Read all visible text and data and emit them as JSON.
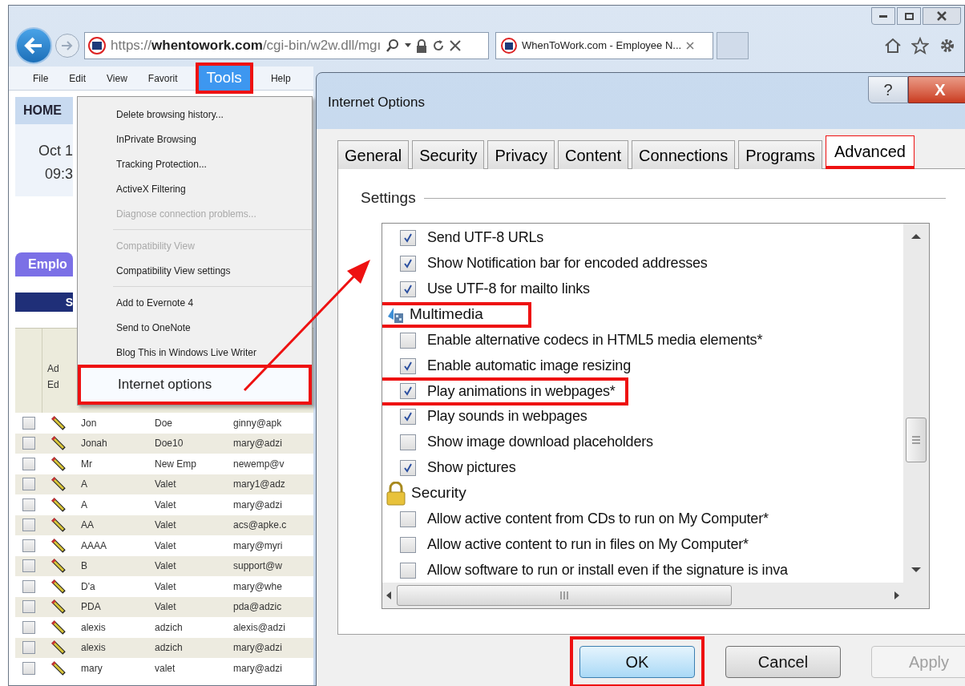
{
  "browser": {
    "address": "https://**whentowork.com**/cgi-bin/w2w.dll/mgı",
    "tab": {
      "title": "WhenToWork.com - Employee N...",
      "selected": true
    }
  },
  "menu_bar": [
    {
      "label": "File",
      "highlighted": false
    },
    {
      "label": "Edit",
      "highlighted": false
    },
    {
      "label": "View",
      "highlighted": false
    },
    {
      "label": "Favorit",
      "highlighted": false
    },
    {
      "label": "Tools",
      "highlighted": true
    },
    {
      "label": "Help",
      "highlighted": false
    }
  ],
  "page": {
    "home_tab": "HOME",
    "date": "Oct 1",
    "time": "09:3",
    "section_tab": "Emplo",
    "bar_label": "S",
    "edit_header": "Ad Ed",
    "rows": [
      {
        "first": "Jon",
        "last": "Doe",
        "email": "ginny@apk",
        "checked": false
      },
      {
        "first": "Jonah",
        "last": "Doe10",
        "email": "mary@adzi",
        "checked": false
      },
      {
        "first": "Mr",
        "last": "New Emp",
        "email": "newemp@v",
        "checked": false
      },
      {
        "first": "A",
        "last": "Valet",
        "email": "mary1@adz",
        "checked": false
      },
      {
        "first": "A",
        "last": "Valet",
        "email": "mary@adzi",
        "checked": false
      },
      {
        "first": "AA",
        "last": "Valet",
        "email": "acs@apke.c",
        "checked": false
      },
      {
        "first": "AAAA",
        "last": "Valet",
        "email": "mary@myri",
        "checked": false
      },
      {
        "first": "B",
        "last": "Valet",
        "email": "support@w",
        "checked": false
      },
      {
        "first": "D'a",
        "last": "Valet",
        "email": "mary@whe",
        "checked": false
      },
      {
        "first": "PDA",
        "last": "Valet",
        "email": "pda@adzic",
        "checked": false
      },
      {
        "first": "alexis",
        "last": "adzich",
        "email": "alexis@adzi",
        "checked": false
      },
      {
        "first": "alexis",
        "last": "adzich",
        "email": "mary@adzi",
        "checked": false
      },
      {
        "first": "mary",
        "last": "valet",
        "email": "mary@adzi",
        "checked": false
      }
    ]
  },
  "tools_menu": [
    {
      "kind": "item",
      "label": "Delete browsing history...",
      "disabled": false,
      "highlighted": false
    },
    {
      "kind": "item",
      "label": "InPrivate Browsing",
      "disabled": false,
      "highlighted": false
    },
    {
      "kind": "item",
      "label": "Tracking Protection...",
      "disabled": false,
      "highlighted": false
    },
    {
      "kind": "item",
      "label": "ActiveX Filtering",
      "disabled": false,
      "highlighted": false
    },
    {
      "kind": "item",
      "label": "Diagnose connection problems...",
      "disabled": true,
      "highlighted": false
    },
    {
      "kind": "separator"
    },
    {
      "kind": "item",
      "label": "Compatibility View",
      "disabled": true,
      "highlighted": false
    },
    {
      "kind": "item",
      "label": "Compatibility View settings",
      "disabled": false,
      "highlighted": false
    },
    {
      "kind": "separator"
    },
    {
      "kind": "item",
      "label": "Add to Evernote 4",
      "disabled": false,
      "highlighted": false
    },
    {
      "kind": "item",
      "label": "Send to OneNote",
      "disabled": false,
      "highlighted": false
    },
    {
      "kind": "item",
      "label": "Blog This in Windows Live Writer",
      "disabled": false,
      "highlighted": false
    },
    {
      "kind": "item",
      "label": "Internet options",
      "disabled": false,
      "highlighted": true
    }
  ],
  "dialog": {
    "title": "Internet Options",
    "help": "?",
    "close": "X",
    "tabs": [
      {
        "label": "General",
        "selected": false,
        "highlighted": false
      },
      {
        "label": "Security",
        "selected": false,
        "highlighted": false
      },
      {
        "label": "Privacy",
        "selected": false,
        "highlighted": false
      },
      {
        "label": "Content",
        "selected": false,
        "highlighted": false
      },
      {
        "label": "Connections",
        "selected": false,
        "highlighted": false
      },
      {
        "label": "Programs",
        "selected": false,
        "highlighted": false
      },
      {
        "label": "Advanced",
        "selected": true,
        "highlighted": true
      }
    ],
    "settings_label": "Settings",
    "settings": [
      {
        "kind": "option",
        "label": "Send UTF-8 URLs",
        "checked": true,
        "highlighted": false
      },
      {
        "kind": "option",
        "label": "Show Notification bar for encoded addresses",
        "checked": true,
        "highlighted": false
      },
      {
        "kind": "option",
        "label": "Use UTF-8 for mailto links",
        "checked": true,
        "highlighted": false
      },
      {
        "kind": "group",
        "label": "Multimedia",
        "highlighted": true
      },
      {
        "kind": "option",
        "label": "Enable alternative codecs in HTML5 media elements*",
        "checked": false,
        "highlighted": false
      },
      {
        "kind": "option",
        "label": "Enable automatic image resizing",
        "checked": true,
        "highlighted": false
      },
      {
        "kind": "option",
        "label": "Play animations in webpages*",
        "checked": true,
        "highlighted": true
      },
      {
        "kind": "option",
        "label": "Play sounds in webpages",
        "checked": true,
        "highlighted": false
      },
      {
        "kind": "option",
        "label": "Show image download placeholders",
        "checked": false,
        "highlighted": false
      },
      {
        "kind": "option",
        "label": "Show pictures",
        "checked": true,
        "highlighted": false
      },
      {
        "kind": "group",
        "label": "Security",
        "highlighted": false
      },
      {
        "kind": "option",
        "label": "Allow active content from CDs to run on My Computer*",
        "checked": false,
        "highlighted": false
      },
      {
        "kind": "option",
        "label": "Allow active content to run in files on My Computer*",
        "checked": false,
        "highlighted": false
      },
      {
        "kind": "option",
        "label": "Allow software to run or install even if the signature is inva",
        "checked": false,
        "highlighted": false
      }
    ],
    "buttons": [
      {
        "label": "OK",
        "default": true,
        "disabled": false,
        "highlighted": true
      },
      {
        "label": "Cancel",
        "default": false,
        "disabled": false,
        "highlighted": false
      },
      {
        "label": "Apply",
        "default": false,
        "disabled": true,
        "highlighted": false
      }
    ]
  }
}
